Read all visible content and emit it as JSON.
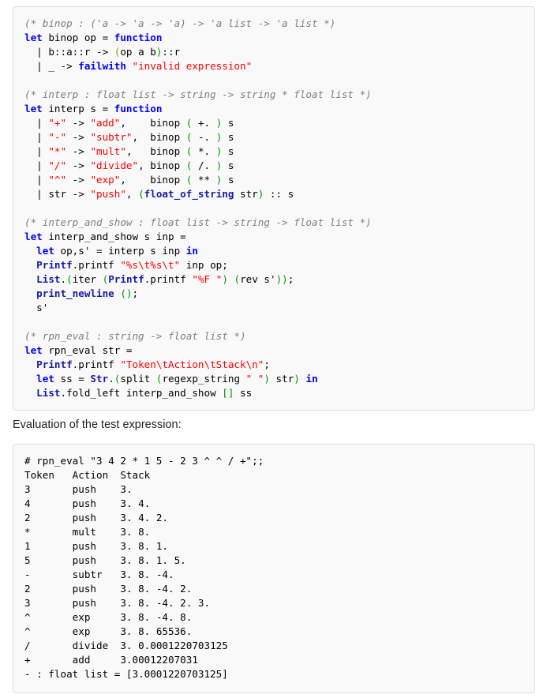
{
  "code_block_1": {
    "lines": [
      [
        {
          "t": "c",
          "v": "(* binop : ('a -> 'a -> 'a) -> 'a list -> 'a list *)"
        }
      ],
      [
        {
          "t": "k",
          "v": "let"
        },
        {
          "t": "n",
          "v": " binop op = "
        },
        {
          "t": "k",
          "v": "function"
        }
      ],
      [
        {
          "t": "n",
          "v": "  | b::a::r -> "
        },
        {
          "t": "po",
          "v": "("
        },
        {
          "t": "n",
          "v": "op a b"
        },
        {
          "t": "p",
          "v": ")"
        },
        {
          "t": "n",
          "v": "::r"
        }
      ],
      [
        {
          "t": "n",
          "v": "  | _ -> "
        },
        {
          "t": "k",
          "v": "failwith"
        },
        {
          "t": "n",
          "v": " "
        },
        {
          "t": "s",
          "v": "\"invalid expression\""
        }
      ],
      [
        {
          "t": "n",
          "v": ""
        }
      ],
      [
        {
          "t": "c",
          "v": "(* interp : float list -> string -> string * float list *)"
        }
      ],
      [
        {
          "t": "k",
          "v": "let"
        },
        {
          "t": "n",
          "v": " interp s = "
        },
        {
          "t": "k",
          "v": "function"
        }
      ],
      [
        {
          "t": "n",
          "v": "  | "
        },
        {
          "t": "s",
          "v": "\"+\""
        },
        {
          "t": "n",
          "v": " -> "
        },
        {
          "t": "s",
          "v": "\"add\""
        },
        {
          "t": "n",
          "v": ",    binop "
        },
        {
          "t": "p",
          "v": "("
        },
        {
          "t": "n",
          "v": " +. "
        },
        {
          "t": "p",
          "v": ")"
        },
        {
          "t": "n",
          "v": " s"
        }
      ],
      [
        {
          "t": "n",
          "v": "  | "
        },
        {
          "t": "s",
          "v": "\"-\""
        },
        {
          "t": "n",
          "v": " -> "
        },
        {
          "t": "s",
          "v": "\"subtr\""
        },
        {
          "t": "n",
          "v": ",  binop "
        },
        {
          "t": "p",
          "v": "("
        },
        {
          "t": "n",
          "v": " -. "
        },
        {
          "t": "p",
          "v": ")"
        },
        {
          "t": "n",
          "v": " s"
        }
      ],
      [
        {
          "t": "n",
          "v": "  | "
        },
        {
          "t": "s",
          "v": "\"*\""
        },
        {
          "t": "n",
          "v": " -> "
        },
        {
          "t": "s",
          "v": "\"mult\""
        },
        {
          "t": "n",
          "v": ",   binop "
        },
        {
          "t": "p",
          "v": "("
        },
        {
          "t": "n",
          "v": " *. "
        },
        {
          "t": "p",
          "v": ")"
        },
        {
          "t": "n",
          "v": " s"
        }
      ],
      [
        {
          "t": "n",
          "v": "  | "
        },
        {
          "t": "s",
          "v": "\"/\""
        },
        {
          "t": "n",
          "v": " -> "
        },
        {
          "t": "s",
          "v": "\"divide\""
        },
        {
          "t": "n",
          "v": ", binop "
        },
        {
          "t": "p",
          "v": "("
        },
        {
          "t": "n",
          "v": " /. "
        },
        {
          "t": "p",
          "v": ")"
        },
        {
          "t": "n",
          "v": " s"
        }
      ],
      [
        {
          "t": "n",
          "v": "  | "
        },
        {
          "t": "s",
          "v": "\"^\""
        },
        {
          "t": "n",
          "v": " -> "
        },
        {
          "t": "s",
          "v": "\"exp\""
        },
        {
          "t": "n",
          "v": ",    binop "
        },
        {
          "t": "p",
          "v": "("
        },
        {
          "t": "n",
          "v": " ** "
        },
        {
          "t": "p",
          "v": ")"
        },
        {
          "t": "n",
          "v": " s"
        }
      ],
      [
        {
          "t": "n",
          "v": "  | str -> "
        },
        {
          "t": "s",
          "v": "\"push\""
        },
        {
          "t": "n",
          "v": ", "
        },
        {
          "t": "p",
          "v": "("
        },
        {
          "t": "m",
          "v": "float_of_string"
        },
        {
          "t": "n",
          "v": " str"
        },
        {
          "t": "p",
          "v": ")"
        },
        {
          "t": "n",
          "v": " :: s"
        }
      ],
      [
        {
          "t": "n",
          "v": ""
        }
      ],
      [
        {
          "t": "c",
          "v": "(* interp_and_show : float list -> string -> float list *)"
        }
      ],
      [
        {
          "t": "k",
          "v": "let"
        },
        {
          "t": "n",
          "v": " interp_and_show s inp ="
        }
      ],
      [
        {
          "t": "n",
          "v": "  "
        },
        {
          "t": "k",
          "v": "let"
        },
        {
          "t": "n",
          "v": " op,s' = interp s inp "
        },
        {
          "t": "k",
          "v": "in"
        }
      ],
      [
        {
          "t": "n",
          "v": "  "
        },
        {
          "t": "m",
          "v": "Printf"
        },
        {
          "t": "n",
          "v": ".printf "
        },
        {
          "t": "s",
          "v": "\"%s\\t%s\\t\""
        },
        {
          "t": "n",
          "v": " inp op;"
        }
      ],
      [
        {
          "t": "n",
          "v": "  "
        },
        {
          "t": "m",
          "v": "List"
        },
        {
          "t": "n",
          "v": "."
        },
        {
          "t": "p",
          "v": "("
        },
        {
          "t": "n",
          "v": "iter "
        },
        {
          "t": "p",
          "v": "("
        },
        {
          "t": "m",
          "v": "Printf"
        },
        {
          "t": "n",
          "v": ".printf "
        },
        {
          "t": "s",
          "v": "\"%F \""
        },
        {
          "t": "p",
          "v": ")"
        },
        {
          "t": "n",
          "v": " "
        },
        {
          "t": "p",
          "v": "("
        },
        {
          "t": "n",
          "v": "rev s'"
        },
        {
          "t": "p",
          "v": "))"
        },
        {
          "t": "n",
          "v": ";"
        }
      ],
      [
        {
          "t": "n",
          "v": "  "
        },
        {
          "t": "m",
          "v": "print_newline"
        },
        {
          "t": "n",
          "v": " "
        },
        {
          "t": "p",
          "v": "()"
        },
        {
          "t": "n",
          "v": ";"
        }
      ],
      [
        {
          "t": "n",
          "v": "  s'"
        }
      ],
      [
        {
          "t": "n",
          "v": ""
        }
      ],
      [
        {
          "t": "c",
          "v": "(* rpn_eval : string -> float list *)"
        }
      ],
      [
        {
          "t": "k",
          "v": "let"
        },
        {
          "t": "n",
          "v": " rpn_eval str ="
        }
      ],
      [
        {
          "t": "n",
          "v": "  "
        },
        {
          "t": "m",
          "v": "Printf"
        },
        {
          "t": "n",
          "v": ".printf "
        },
        {
          "t": "s",
          "v": "\"Token\\tAction\\tStack\\n\""
        },
        {
          "t": "n",
          "v": ";"
        }
      ],
      [
        {
          "t": "n",
          "v": "  "
        },
        {
          "t": "k",
          "v": "let"
        },
        {
          "t": "n",
          "v": " ss = "
        },
        {
          "t": "m",
          "v": "Str"
        },
        {
          "t": "n",
          "v": "."
        },
        {
          "t": "p",
          "v": "("
        },
        {
          "t": "n",
          "v": "split "
        },
        {
          "t": "p",
          "v": "("
        },
        {
          "t": "n",
          "v": "regexp_string "
        },
        {
          "t": "s",
          "v": "\" \""
        },
        {
          "t": "p",
          "v": ")"
        },
        {
          "t": "n",
          "v": " str"
        },
        {
          "t": "p",
          "v": ")"
        },
        {
          "t": "n",
          "v": " "
        },
        {
          "t": "k",
          "v": "in"
        }
      ],
      [
        {
          "t": "n",
          "v": "  "
        },
        {
          "t": "m",
          "v": "List"
        },
        {
          "t": "n",
          "v": ".fold_left interp_and_show "
        },
        {
          "t": "p",
          "v": "[]"
        },
        {
          "t": "n",
          "v": " ss"
        }
      ]
    ]
  },
  "label": "Evaluation of the test expression:",
  "code_block_2": {
    "command": "# rpn_eval \"3 4 2 * 1 5 - 2 3 ^ ^ / +\";;",
    "header": {
      "token": "Token",
      "action": "Action",
      "stack": "Stack"
    },
    "rows": [
      {
        "token": "3",
        "action": "push",
        "stack": "3."
      },
      {
        "token": "4",
        "action": "push",
        "stack": "3. 4."
      },
      {
        "token": "2",
        "action": "push",
        "stack": "3. 4. 2."
      },
      {
        "token": "*",
        "action": "mult",
        "stack": "3. 8."
      },
      {
        "token": "1",
        "action": "push",
        "stack": "3. 8. 1."
      },
      {
        "token": "5",
        "action": "push",
        "stack": "3. 8. 1. 5."
      },
      {
        "token": "-",
        "action": "subtr",
        "stack": "3. 8. -4."
      },
      {
        "token": "2",
        "action": "push",
        "stack": "3. 8. -4. 2."
      },
      {
        "token": "3",
        "action": "push",
        "stack": "3. 8. -4. 2. 3."
      },
      {
        "token": "^",
        "action": "exp",
        "stack": "3. 8. -4. 8."
      },
      {
        "token": "^",
        "action": "exp",
        "stack": "3. 8. 65536."
      },
      {
        "token": "/",
        "action": "divide",
        "stack": "3. 0.0001220703125"
      },
      {
        "token": "+",
        "action": "add",
        "stack": "3.00012207031"
      }
    ],
    "result": "- : float list = [3.0001220703125]"
  }
}
